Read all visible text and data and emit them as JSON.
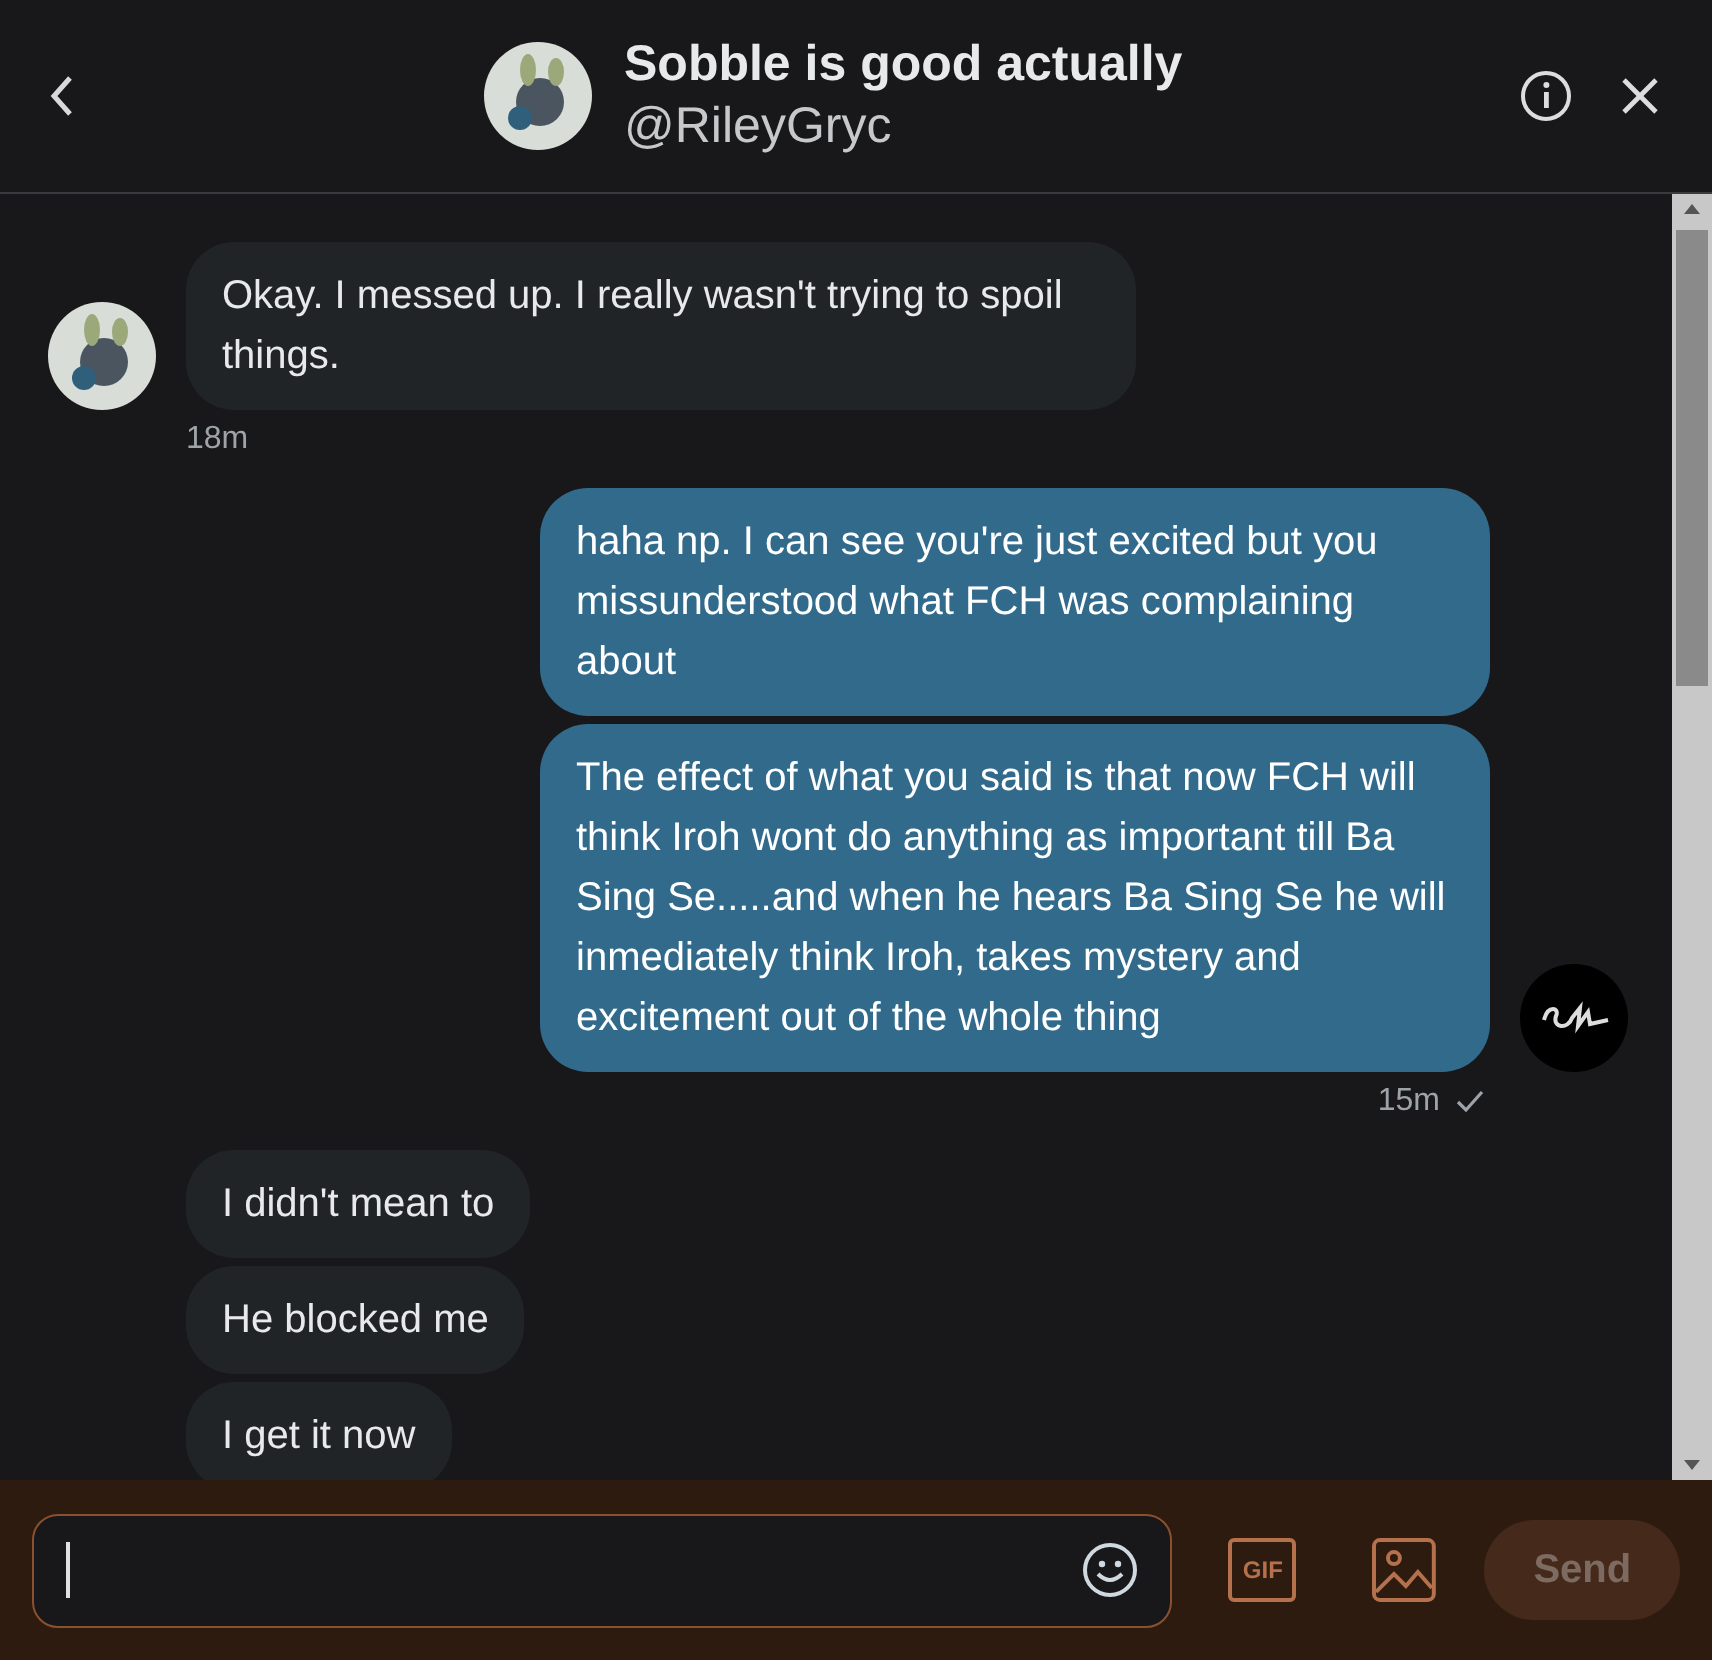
{
  "header": {
    "title": "Sobble is good actually",
    "handle": "@RileyGryc"
  },
  "groups": [
    {
      "kind": "incoming",
      "avatar": true,
      "messages": [
        "Okay. I messed up. I really wasn't trying to spoil things."
      ],
      "time": "18m",
      "read": false
    },
    {
      "kind": "outgoing",
      "avatar": true,
      "messages": [
        "haha np. I can see you're just excited but you missunderstood what FCH was complaining about",
        "The effect of what you said is that now FCH will think Iroh wont do anything as important till Ba Sing Se.....and when he hears Ba Sing Se he will inmediately think Iroh, takes mystery and excitement out of the whole thing"
      ],
      "time": "15m",
      "read": true
    },
    {
      "kind": "incoming",
      "avatar": false,
      "messages": [
        "I didn't mean to",
        "He blocked me",
        "I get it now"
      ]
    }
  ],
  "composer": {
    "gif": "GIF",
    "send": {
      "label": "Send",
      "disabled": true
    }
  }
}
